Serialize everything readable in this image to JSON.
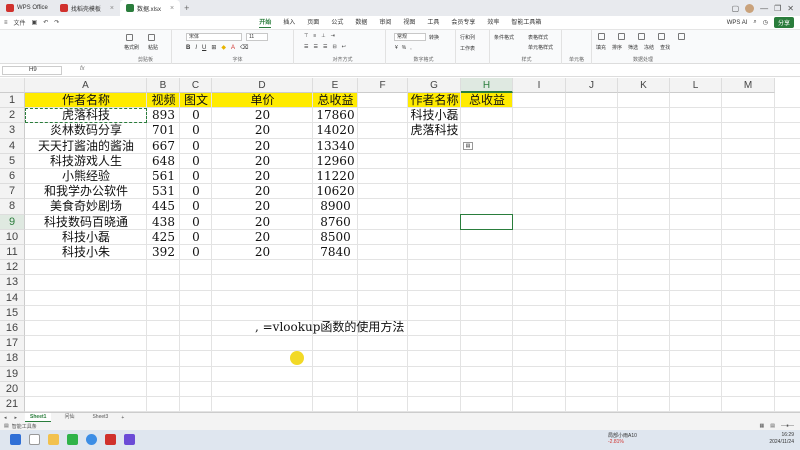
{
  "titlebar": {
    "tabs": [
      {
        "label": "WPS Office",
        "color": "#d0312d"
      },
      {
        "label": "找稻壳模板",
        "color": "#d0312d"
      },
      {
        "label": "数据.xlsx",
        "color": "#2a7d3c"
      }
    ]
  },
  "menubar": {
    "file": "文件",
    "tabs": [
      "开始",
      "插入",
      "页面",
      "公式",
      "数据",
      "审阅",
      "视图",
      "工具",
      "会员专享",
      "效率",
      "智能工具箱"
    ],
    "active_tab": "开始",
    "wps_ai": "WPS AI",
    "share": "分享"
  },
  "ribbon": {
    "groups": [
      "剪贴板",
      "字体",
      "对齐方式",
      "数字格式",
      "样式",
      "单元格",
      "数据处理"
    ],
    "format_painter": "格式刷",
    "paste": "粘贴",
    "font_name": "宋体",
    "font_size": "11",
    "number_format": "常规",
    "convert": "转换",
    "rows_cols": "行和列",
    "worksheet": "工作表",
    "cond_format": "条件格式",
    "table_style": "表格样式",
    "cell_style": "单元格样式",
    "fill": "填充",
    "sort": "排序",
    "filter": "筛选",
    "freeze": "冻结",
    "find": "查找"
  },
  "formula_bar": {
    "name_box": "H9",
    "fx": "fx",
    "value": ""
  },
  "columns": [
    "A",
    "B",
    "C",
    "D",
    "E",
    "F",
    "G",
    "H",
    "I",
    "J",
    "K",
    "L",
    "M"
  ],
  "rows": [
    "1",
    "2",
    "3",
    "4",
    "5",
    "6",
    "7",
    "8",
    "9",
    "10",
    "11",
    "12",
    "13",
    "14",
    "15",
    "16",
    "17",
    "18",
    "19",
    "20",
    "21"
  ],
  "selected_cell": "H9",
  "table": {
    "headers": [
      "作者名称",
      "视频",
      "图文",
      "单价",
      "总收益"
    ],
    "rows": [
      [
        "虎落科技",
        "893",
        "0",
        "20",
        "17860"
      ],
      [
        "炎林数码分享",
        "701",
        "0",
        "20",
        "14020"
      ],
      [
        "天天打酱油的酱油",
        "667",
        "0",
        "20",
        "13340"
      ],
      [
        "科技游戏人生",
        "648",
        "0",
        "20",
        "12960"
      ],
      [
        "小熊经验",
        "561",
        "0",
        "20",
        "11220"
      ],
      [
        "和我学办公软件",
        "531",
        "0",
        "20",
        "10620"
      ],
      [
        "美食奇妙剧场",
        "445",
        "0",
        "20",
        "8900"
      ],
      [
        "科技数码百晓通",
        "438",
        "0",
        "20",
        "8760"
      ],
      [
        "科技小磊",
        "425",
        "0",
        "20",
        "8500"
      ],
      [
        "科技小朱",
        "392",
        "0",
        "20",
        "7840"
      ]
    ]
  },
  "lookup": {
    "headers": [
      "作者名称",
      "总收益"
    ],
    "rows": [
      "科技小磊",
      "虎落科技"
    ]
  },
  "note": ", =vlookup函数的使用方法",
  "highlight_color": "#ffeb00",
  "accent_color": "#2a7d3c",
  "sheets": {
    "tabs": [
      "Sheet1",
      "问仙",
      "Sheet3"
    ],
    "active": "Sheet1"
  },
  "status": {
    "label": "智能工具条"
  },
  "taskbar": {
    "weather_temp": "局部小雨A10",
    "weather_change": "-2.81%",
    "time": "16:29",
    "date": "2024/11/24"
  }
}
